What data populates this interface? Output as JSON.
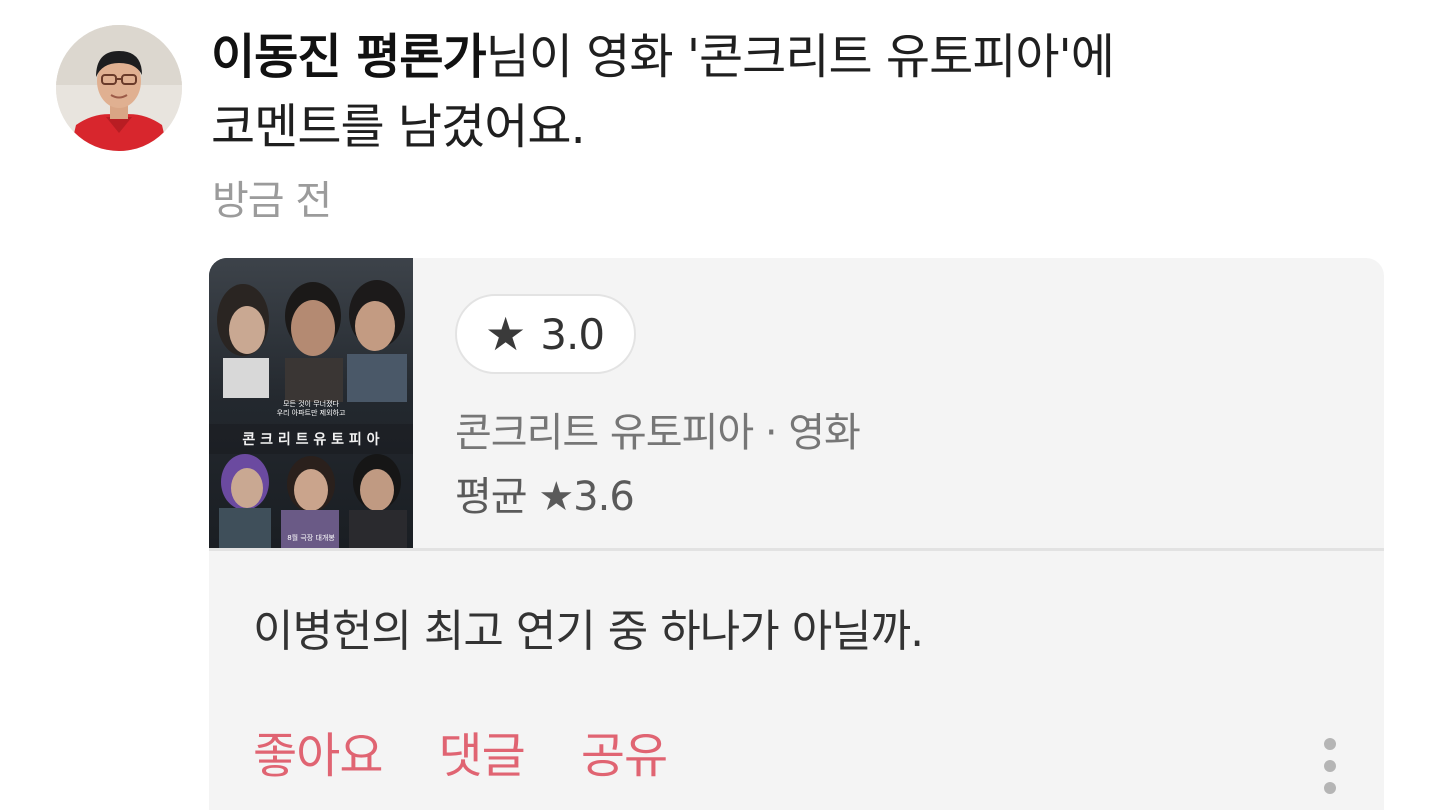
{
  "activity": {
    "author": "이동진 평론가",
    "message_line1": "님이 영화 '콘크리트 유토피아'에",
    "message_line2": "코멘트를 남겼어요.",
    "timestamp": "방금 전"
  },
  "card": {
    "poster": {
      "tagline_line1": "모든 것이 무너졌다",
      "tagline_line2": "우리 아파트만 제외하고",
      "title_text": "콘 크 리 트 유 토 피 아",
      "release_text": "8월 극장 대개봉"
    },
    "rating": {
      "star_icon": "★",
      "value": "3.0"
    },
    "movie_meta": "콘크리트 유토피아 · 영화",
    "average": "평균 ★3.6",
    "comment": "이병헌의 최고 연기 중 하나가 아닐까.",
    "actions": {
      "like": "좋아요",
      "comment": "댓글",
      "share": "공유"
    }
  },
  "colors": {
    "accent": "#e06472",
    "card_bg": "#f4f4f4",
    "muted_text": "#9b9b9b"
  }
}
